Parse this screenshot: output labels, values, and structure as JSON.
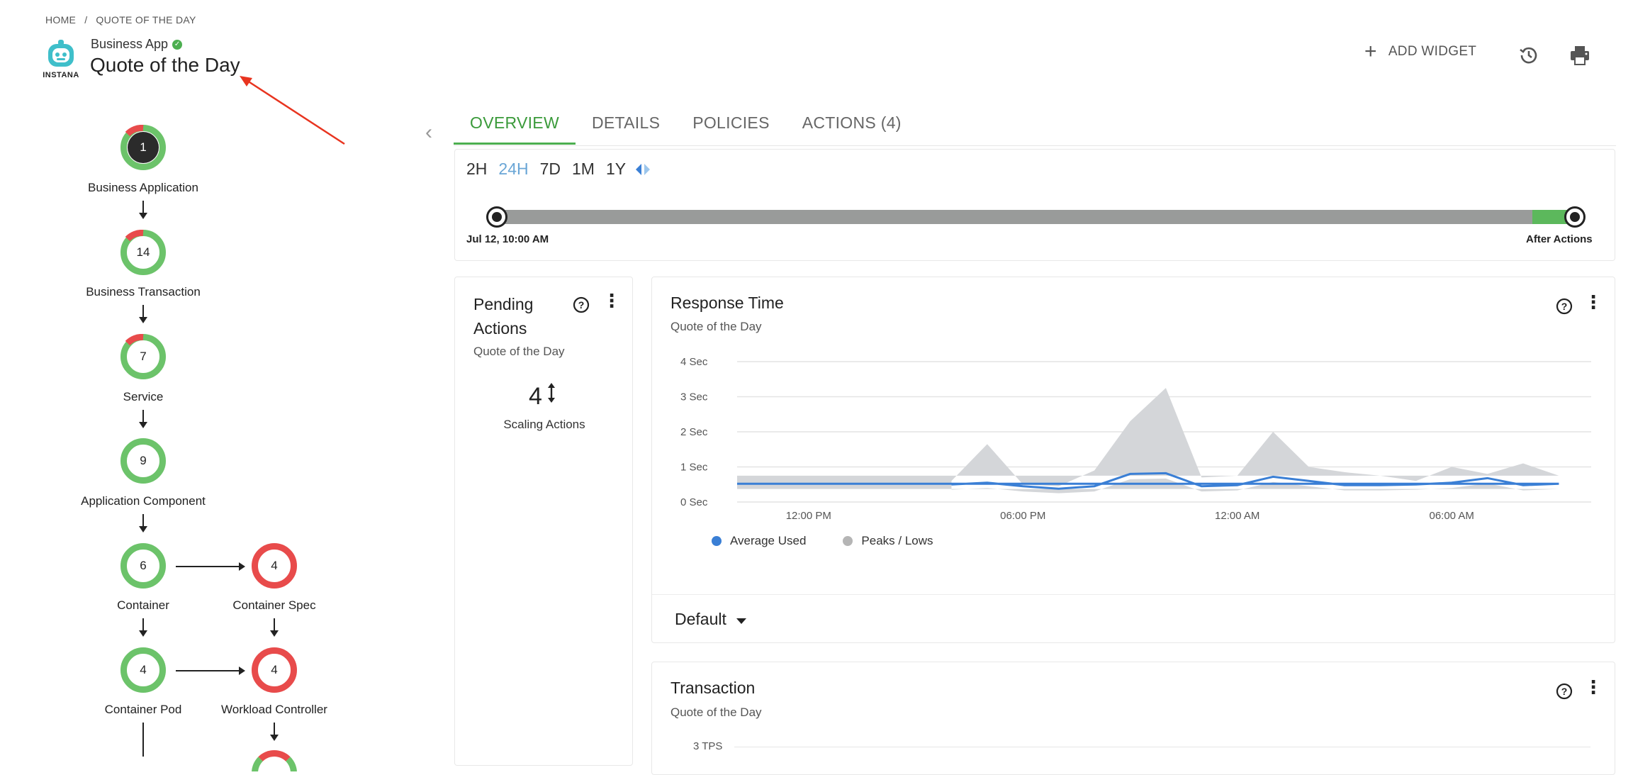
{
  "breadcrumb": {
    "home": "HOME",
    "separator": "/",
    "current": "QUOTE OF THE DAY"
  },
  "logo": {
    "text": "INSTANA"
  },
  "header": {
    "app_type": "Business App",
    "title": "Quote of the Day"
  },
  "toolbar": {
    "add_widget": "ADD WIDGET"
  },
  "supply_chain": [
    {
      "value": "1",
      "label": "Business Application",
      "status": "mixed"
    },
    {
      "value": "14",
      "label": "Business Transaction",
      "status": "mixed"
    },
    {
      "value": "7",
      "label": "Service",
      "status": "mixed"
    },
    {
      "value": "9",
      "label": "Application Component",
      "status": "green"
    },
    {
      "value": "6",
      "label": "Container",
      "status": "green"
    },
    {
      "value": "4",
      "label": "Container Spec",
      "status": "red"
    },
    {
      "value": "4",
      "label": "Container Pod",
      "status": "green"
    },
    {
      "value": "4",
      "label": "Workload Controller",
      "status": "red"
    }
  ],
  "tabs": [
    {
      "label": "OVERVIEW",
      "active": true
    },
    {
      "label": "DETAILS",
      "active": false
    },
    {
      "label": "POLICIES",
      "active": false
    },
    {
      "label": "ACTIONS (4)",
      "active": false
    }
  ],
  "time_ranges": [
    "2H",
    "24H",
    "7D",
    "1M",
    "1Y"
  ],
  "selected_range": "24H",
  "timeline": {
    "start_label": "Jul 12, 10:00 AM",
    "end_label": "After Actions"
  },
  "pending_actions": {
    "title": "Pending Actions",
    "subtitle": "Quote of the Day",
    "count": "4",
    "count_label": "Scaling Actions"
  },
  "response_time": {
    "title": "Response Time",
    "subtitle": "Quote of the Day",
    "y_ticks": [
      "4 Sec",
      "3 Sec",
      "2 Sec",
      "1 Sec",
      "0 Sec"
    ],
    "x_ticks": [
      "12:00 PM",
      "06:00 PM",
      "12:00 AM",
      "06:00 AM"
    ],
    "legend": [
      {
        "label": "Average Used",
        "color": "#3a7fd5"
      },
      {
        "label": "Peaks / Lows",
        "color": "#b5b5b5"
      }
    ],
    "selector": "Default"
  },
  "chart_data": {
    "type": "area",
    "title": "Response Time",
    "ylabel": "",
    "xlabel": "",
    "ylim": [
      0,
      4
    ],
    "x_ticks": [
      "12:00 PM",
      "06:00 PM",
      "12:00 AM",
      "06:00 AM"
    ],
    "x_hours": [
      16,
      17,
      18,
      19,
      20,
      21,
      22,
      23,
      0,
      1,
      2,
      3,
      4,
      5,
      6,
      7,
      8,
      9,
      10
    ],
    "series": [
      {
        "name": "Average Used",
        "values": [
          0.5,
          0.55,
          0.45,
          0.38,
          0.45,
          0.8,
          0.82,
          0.45,
          0.48,
          0.72,
          0.6,
          0.48,
          0.48,
          0.5,
          0.55,
          0.68,
          0.48,
          0.52,
          0.52
        ]
      },
      {
        "name": "Peaks / Lows",
        "values": [
          0.6,
          1.65,
          0.5,
          0.45,
          0.9,
          2.3,
          3.25,
          0.7,
          0.75,
          2.0,
          1.0,
          0.85,
          0.75,
          0.6,
          1.0,
          0.8,
          1.1,
          0.75,
          0.75
        ]
      }
    ]
  },
  "transaction": {
    "title": "Transaction",
    "subtitle": "Quote of the Day",
    "y_tick": "3 TPS"
  },
  "colors": {
    "accent": "#4caf50",
    "critical": "#e84b4b",
    "link": "#6aa6d6"
  }
}
